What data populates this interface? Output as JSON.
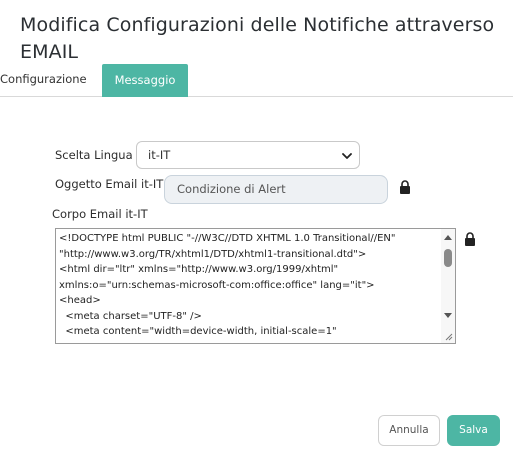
{
  "header": {
    "title": "Modifica Configurazioni delle Notifiche attraverso EMAIL"
  },
  "tabs": [
    {
      "label": "Configurazione",
      "active": false
    },
    {
      "label": "Messaggio",
      "active": true
    }
  ],
  "form": {
    "language_label": "Scelta Lingua",
    "language_value": "it-IT",
    "subject_label": "Oggetto Email it-IT",
    "subject_value": "Condizione di Alert",
    "body_label": "Corpo Email it-IT",
    "body_value": "<!DOCTYPE html PUBLIC \"-//W3C//DTD XHTML 1.0 Transitional//EN\" \"http://www.w3.org/TR/xhtml1/DTD/xhtml1-transitional.dtd\">\n<html dir=\"ltr\" xmlns=\"http://www.w3.org/1999/xhtml\" xmlns:o=\"urn:schemas-microsoft-com:office:office\" lang=\"it\">\n<head>\n  <meta charset=\"UTF-8\" />\n  <meta content=\"width=device-width, initial-scale=1\""
  },
  "actions": {
    "cancel_label": "Annulla",
    "save_label": "Salva"
  },
  "icons": {
    "lock": "lock-icon",
    "select_chevron": "chevron-down-icon"
  },
  "colors": {
    "accent": "#4db6a4",
    "subject_bg": "#eef1f4"
  }
}
